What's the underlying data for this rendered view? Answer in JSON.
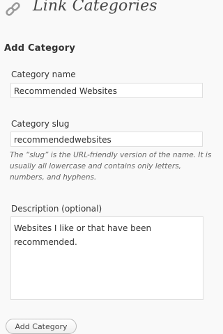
{
  "header": {
    "title": "Link Categories",
    "icon": "link-chain-icon"
  },
  "form": {
    "section_title": "Add Category",
    "name_label": "Category name",
    "name_value": "Recommended Websites",
    "slug_label": "Category slug",
    "slug_value": "recommendedwebsites",
    "slug_help": "The “slug” is the URL-friendly version of the name. It is usually all lowercase and contains only letters, numbers, and hyphens.",
    "description_label": "Description (optional)",
    "description_value": "Websites I like or that have been recommended.",
    "submit_label": "Add Category"
  }
}
